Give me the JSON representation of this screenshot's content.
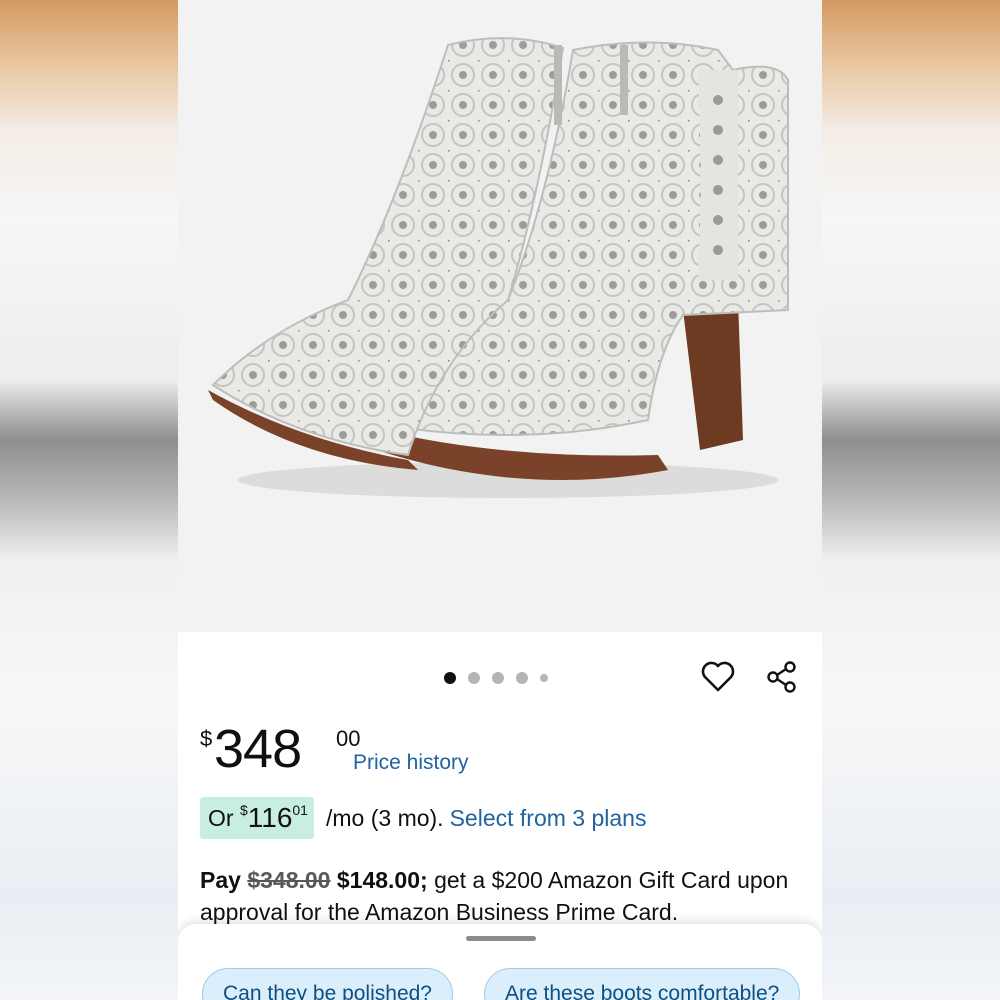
{
  "product": {
    "image_alt": "White embellished western ankle boots with wooden heel",
    "carousel_count": 5,
    "carousel_active": 1
  },
  "actions": {
    "wishlist_icon": "heart-icon",
    "share_icon": "share-icon"
  },
  "price": {
    "currency": "$",
    "whole": "348",
    "fraction": "00",
    "history_link": "Price history"
  },
  "installment": {
    "prefix": "Or",
    "currency": "$",
    "whole": "116",
    "fraction": "01",
    "suffix": "/mo (3 mo).",
    "link": "Select from 3 plans"
  },
  "offer": {
    "pay": "Pay",
    "old_price": "$348.00",
    "new_price": "$148.00;",
    "text": "get a $200 Amazon Gift Card upon approval for the Amazon Business Prime Card."
  },
  "questions": [
    "Can they be polished?",
    "Are these boots comfortable?"
  ],
  "colors": {
    "link": "#2162a1",
    "installment_bg": "#c8eee3",
    "chip_bg": "#dbeefb"
  }
}
